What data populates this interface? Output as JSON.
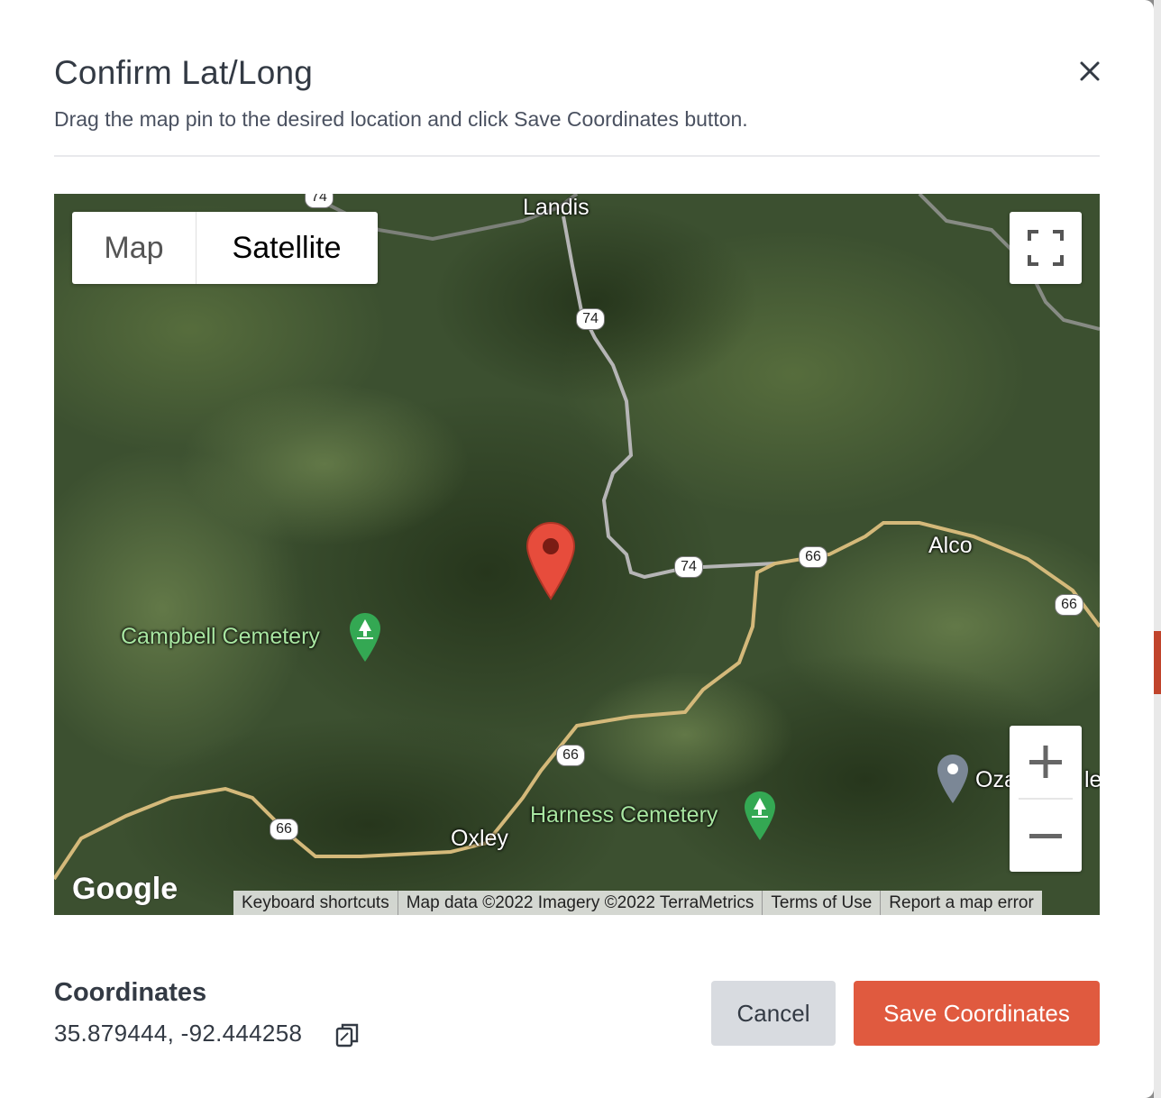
{
  "modal": {
    "title": "Confirm Lat/Long",
    "subtitle": "Drag the map pin to the desired location and click Save Coordinates button.",
    "close_icon": "close-icon"
  },
  "map": {
    "type_options": [
      "Map",
      "Satellite"
    ],
    "selected_type": "Satellite",
    "places": {
      "landis": "Landis",
      "alco": "Alco",
      "oxley": "Oxley",
      "campbell_cemetery": "Campbell Cemetery",
      "harness_cemetery": "Harness Cemetery",
      "ozark_partial": "Oza",
      "ozark_tail": "le"
    },
    "route_shields": {
      "r74_top": "74",
      "r74_mid": "74",
      "r74_east": "74",
      "r66_a": "66",
      "r66_b": "66",
      "r66_c": "66",
      "r66_d": "66"
    },
    "google_logo": "Google",
    "attribution": {
      "keyboard": "Keyboard shortcuts",
      "map_data": "Map data ©2022 Imagery ©2022 TerraMetrics",
      "terms": "Terms of Use",
      "report": "Report a map error"
    },
    "pin_color": "#e74c3c"
  },
  "coordinates": {
    "label": "Coordinates",
    "value": "35.879444, -92.444258"
  },
  "buttons": {
    "cancel": "Cancel",
    "save": "Save Coordinates"
  },
  "colors": {
    "save_bg": "#e05a3f",
    "cancel_bg": "#d8dbe0",
    "text": "#333a44"
  }
}
